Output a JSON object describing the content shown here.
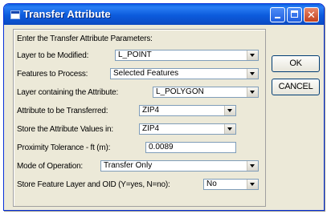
{
  "window": {
    "title": "Transfer Attribute"
  },
  "form": {
    "heading": "Enter the Transfer Attribute Parameters:",
    "layer_modified": {
      "label": "Layer to be Modified:",
      "value": "L_POINT"
    },
    "features_to_process": {
      "label": "Features to Process:",
      "value": "Selected Features"
    },
    "layer_containing": {
      "label": "Layer containing the Attribute:",
      "value": "L_POLYGON"
    },
    "attribute_transferred": {
      "label": "Attribute to be Transferred:",
      "value": "ZIP4"
    },
    "store_values_in": {
      "label": "Store the Attribute Values in:",
      "value": "ZIP4"
    },
    "proximity_tolerance": {
      "label": "Proximity Tolerance - ft (m):",
      "value": "0.0089"
    },
    "mode_of_operation": {
      "label": "Mode of Operation:",
      "value": "Transfer Only"
    },
    "store_feature_layer": {
      "label": "Store Feature Layer and OID (Y=yes, N=no):",
      "value": "No"
    }
  },
  "buttons": {
    "ok": "OK",
    "cancel": "CANCEL"
  }
}
